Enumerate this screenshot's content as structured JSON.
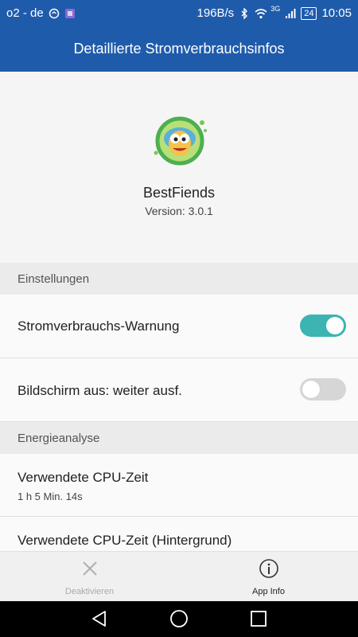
{
  "status_bar": {
    "carrier": "o2 - de",
    "data_rate": "196B/s",
    "network_type": "3G",
    "battery": "24",
    "time": "10:05"
  },
  "app_bar": {
    "title": "Detaillierte Stromverbrauchsinfos"
  },
  "app": {
    "name": "BestFiends",
    "version": "Version: 3.0.1"
  },
  "sections": {
    "settings": {
      "header": "Einstellungen",
      "rows": [
        {
          "label": "Stromverbrauchs-Warnung",
          "toggle": "on"
        },
        {
          "label": "Bildschirm aus: weiter ausf.",
          "toggle": "off"
        }
      ]
    },
    "analysis": {
      "header": "Energieanalyse",
      "rows": [
        {
          "label": "Verwendete CPU-Zeit",
          "value": "1 h 5 Min. 14s"
        },
        {
          "label": "Verwendete CPU-Zeit (Hintergrund)"
        }
      ]
    }
  },
  "actions": {
    "deactivate": "Deaktivieren",
    "app_info": "App Info"
  },
  "colors": {
    "primary": "#1f5bab",
    "toggle_on": "#3cb4b2",
    "toggle_off": "#d6d6d6"
  }
}
